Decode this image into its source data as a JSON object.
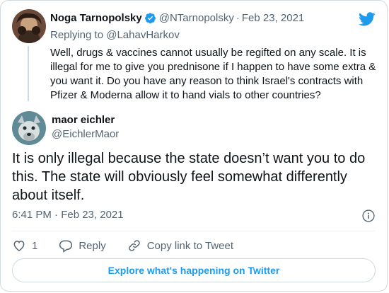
{
  "parent_tweet": {
    "author_name": "Noga Tarnopolsky",
    "handle": "@NTarnopolsky",
    "separator": "·",
    "date": "Feb 23, 2021",
    "replying_prefix": "Replying to",
    "replying_to": "@LahavHarkov",
    "text": "Well, drugs & vaccines cannot usually be regifted on any scale. It is illegal for me to give you prednisone if I happen to have some extra & you want it. Do you have any reason to think Israel's contracts with Pfizer & Moderna allow it to hand vials to other countries?"
  },
  "main_tweet": {
    "author_name": "maor eichler",
    "handle": "@EichlerMaor",
    "text": "It is only illegal because the state doesn’t want you to do this. The state will obviously feel somewhat differently about itself.",
    "timestamp": "6:41 PM · Feb 23, 2021"
  },
  "actions": {
    "like_count": "1",
    "reply_label": "Reply",
    "copy_link_label": "Copy link to Tweet"
  },
  "explore_button": "Explore what's happening on Twitter",
  "colors": {
    "brand": "#1d9bf0",
    "text_primary": "#0f1419",
    "text_secondary": "#536471",
    "border": "#cfd9de"
  },
  "icons": [
    "twitter-bird-icon",
    "verified-badge-icon",
    "info-icon",
    "heart-icon",
    "reply-bubble-icon",
    "link-icon"
  ]
}
